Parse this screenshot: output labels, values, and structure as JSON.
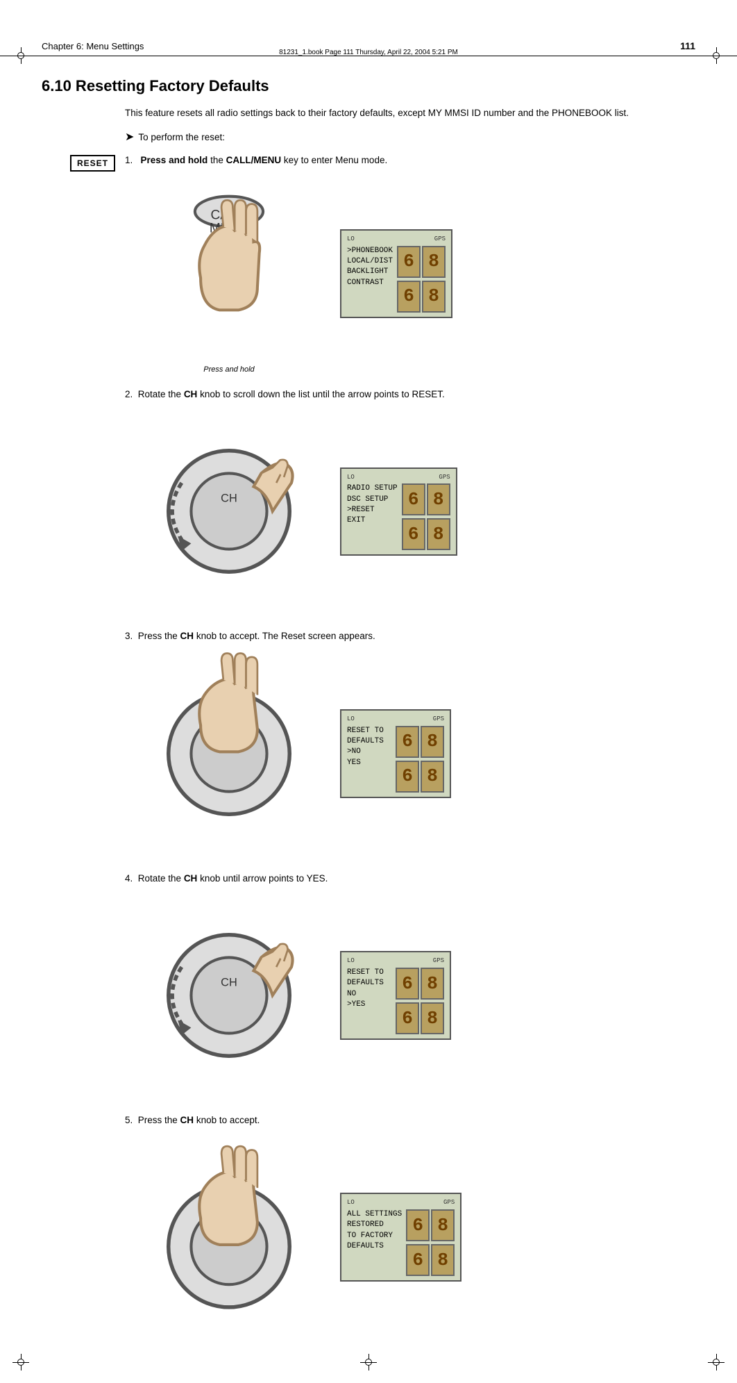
{
  "meta": {
    "file_info": "81231_1.book  Page 111  Thursday, April 22, 2004  5:21 PM"
  },
  "header": {
    "chapter": "Chapter 6: Menu Settings",
    "page_number": "111"
  },
  "section": {
    "title": "6.10 Resetting Factory Defaults",
    "intro": "This feature resets all radio settings back to their factory defaults, except MY MMSI ID number and the PHONEBOOK list.",
    "arrow_text": "To perform the reset:",
    "reset_badge": "RESET",
    "steps": [
      {
        "number": "1.",
        "text_pre": "Press and hold",
        "text_bold": " the ",
        "key_name": "CALL/MENU",
        "text_post": " key to enter Menu mode.",
        "has_badge": true,
        "illustration": {
          "hand_type": "press_hold",
          "label": "Press and hold",
          "screen_lines": [
            ">PHONEBOOK",
            "LOCAL/DIST",
            "BACKLIGHT",
            "CONTRAST"
          ],
          "lo_label": "LO",
          "gps_label": "GPS",
          "digits_top": "68",
          "digits_bottom": "68"
        }
      },
      {
        "number": "2.",
        "text_pre": "Rotate the ",
        "key_name": "CH",
        "text_post": " knob to scroll down the list until the arrow points to RESET.",
        "has_badge": false,
        "illustration": {
          "hand_type": "rotate",
          "label": "",
          "screen_lines": [
            "RADIO SETUP",
            "DSC SETUP",
            ">RESET",
            "EXIT"
          ],
          "lo_label": "LO",
          "gps_label": "GPS",
          "digits_top": "68",
          "digits_bottom": "68"
        }
      },
      {
        "number": "3.",
        "text_pre": "Press the ",
        "key_name": "CH",
        "text_post": " knob to accept. The Reset screen appears.",
        "has_badge": false,
        "illustration": {
          "hand_type": "press",
          "label": "",
          "screen_lines": [
            "RESET TO",
            "DEFAULTS",
            ">NO",
            "YES"
          ],
          "lo_label": "LO",
          "gps_label": "GPS",
          "digits_top": "68",
          "digits_bottom": "68"
        }
      },
      {
        "number": "4.",
        "text_pre": "Rotate the ",
        "key_name": "CH",
        "text_post": " knob until arrow points to YES.",
        "has_badge": false,
        "illustration": {
          "hand_type": "rotate",
          "label": "",
          "screen_lines": [
            "RESET TO",
            "DEFAULTS",
            "NO",
            ">YES"
          ],
          "lo_label": "LO",
          "gps_label": "GPS",
          "digits_top": "68",
          "digits_bottom": "68"
        }
      },
      {
        "number": "5.",
        "text_pre": "Press the ",
        "key_name": "CH",
        "text_post": " knob to accept.",
        "has_badge": false,
        "illustration": {
          "hand_type": "press",
          "label": "",
          "screen_lines": [
            "ALL SETTINGS",
            "RESTORED",
            "TO FACTORY",
            "DEFAULTS"
          ],
          "lo_label": "LO",
          "gps_label": "GPS",
          "digits_top": "68",
          "digits_bottom": "68"
        }
      }
    ]
  }
}
